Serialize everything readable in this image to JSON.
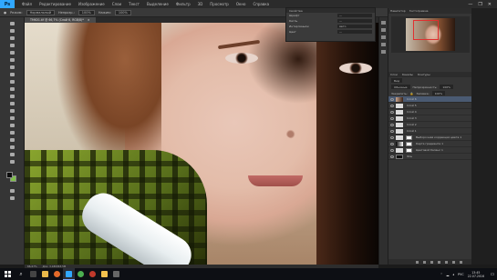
{
  "menubar": {
    "logo": "Ps",
    "items": [
      "Файл",
      "Редактирование",
      "Изображение",
      "Слои",
      "Текст",
      "Выделение",
      "Фильтр",
      "3D",
      "Просмотр",
      "Окно",
      "Справка"
    ],
    "win_controls": [
      "—",
      "❐",
      "✕"
    ]
  },
  "options": {
    "mode_label": "Режим:",
    "mode_value": "Нормальный",
    "opacity_label": "Непрозр.:",
    "opacity_value": "100%",
    "flow_label": "Нажим:",
    "flow_value": "100%",
    "workspace": "Основная рабочая среда"
  },
  "tab": {
    "title": "TMK01.tif @ 66,7% (Слой 6, RGB/8)*",
    "close": "×"
  },
  "properties": {
    "title": "Свойства",
    "rows": [
      {
        "label": "Шрифт",
        "value": "—"
      },
      {
        "label": "Кегль",
        "value": "—"
      },
      {
        "label": "Интерлиньяж",
        "value": "Авто"
      },
      {
        "label": "Цвет",
        "value": "—"
      }
    ]
  },
  "navigator": {
    "tabs": [
      "Навигатор",
      "Гистограмма"
    ]
  },
  "layers": {
    "tabs": [
      "Слои",
      "Каналы",
      "Контуры"
    ],
    "filter_label": "Вид",
    "blend_mode": "Обычные",
    "opacity_label": "Непрозрачность:",
    "opacity_value": "100%",
    "lock_label": "Закрепить:",
    "fill_label": "Заливка:",
    "fill_value": "100%",
    "items": [
      {
        "name": "Слой 6",
        "thumb": "photo",
        "selected": true
      },
      {
        "name": "Слой 5",
        "thumb": "light"
      },
      {
        "name": "Слой 4",
        "thumb": "light"
      },
      {
        "name": "Слой 3",
        "thumb": "light"
      },
      {
        "name": "Слой 2",
        "thumb": "light"
      },
      {
        "name": "Слой 1",
        "thumb": "light"
      },
      {
        "name": "Выборочная коррекция цвета 1",
        "thumb": "light",
        "mask": true
      },
      {
        "name": "Карта градиента 1",
        "thumb": "grad",
        "mask": true
      },
      {
        "name": "Цветовой баланс 1",
        "thumb": "light",
        "mask": true
      },
      {
        "name": "Фон",
        "thumb": "dark"
      }
    ]
  },
  "status": {
    "zoom": "66,67%",
    "doc": "Док: 3,18M/63,5M"
  },
  "taskbar": {
    "search_icon": "⌕",
    "time": "13:45",
    "date": "22.07.2016",
    "lang": "РУС",
    "notif_icon": "▭",
    "apps": [
      {
        "name": "task-view",
        "color": "#444"
      },
      {
        "name": "explorer",
        "color": "#e8b84a"
      },
      {
        "name": "firefox",
        "color": "#e56a2a"
      },
      {
        "name": "photoshop",
        "color": "#31a8ff",
        "active": true
      },
      {
        "name": "chrome",
        "color": "#4caf50"
      },
      {
        "name": "media",
        "color": "#c0392b"
      },
      {
        "name": "folder",
        "color": "#f2c14e"
      },
      {
        "name": "app-8",
        "color": "#666"
      }
    ]
  },
  "colors": {
    "foreground": "#0d0d0d",
    "background": "#7fc04a"
  }
}
